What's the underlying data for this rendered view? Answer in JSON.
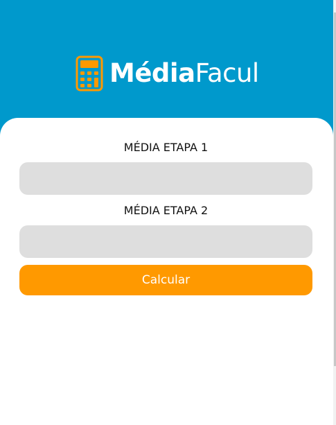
{
  "colors": {
    "header_bg": "#0099cc",
    "accent": "#ff9900",
    "field_bg": "#dedede"
  },
  "brand": {
    "icon": "calculator-icon",
    "name_bold": "Média",
    "name_light": "Facul"
  },
  "form": {
    "stage1_label": "MÉDIA ETAPA 1",
    "stage1_value": "",
    "stage2_label": "MÉDIA ETAPA 2",
    "stage2_value": "",
    "calculate_label": "Calcular"
  }
}
